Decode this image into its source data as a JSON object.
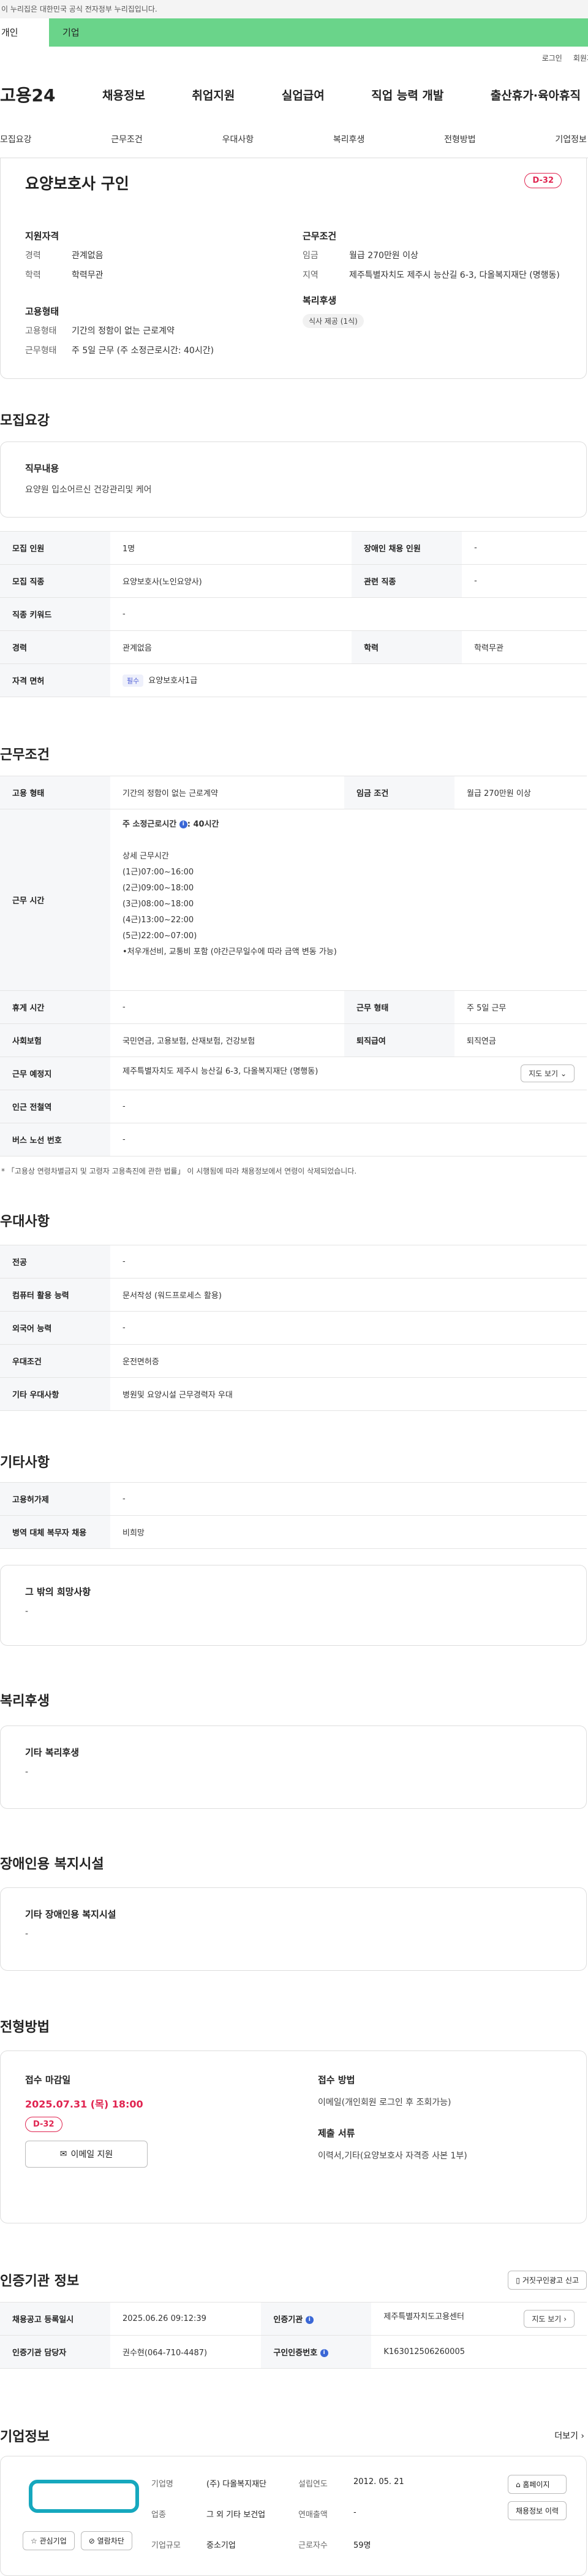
{
  "topbar": {
    "notice": "이 누리집은 대한민국 공식 전자정부 누리집입니다."
  },
  "tabs": [
    {
      "label": "개인"
    },
    {
      "label": "기업"
    }
  ],
  "util": {
    "login": "로그인",
    "join": "회원가입"
  },
  "gnb": {
    "logo": "고용24",
    "menu": [
      "채용정보",
      "취업지원",
      "실업급여",
      "직업 능력 개발",
      "출산휴가·육아휴직"
    ]
  },
  "anchors": [
    "모집요강",
    "근무조건",
    "우대사항",
    "복리후생",
    "전형방법",
    "기업정보"
  ],
  "summary": {
    "title": "요양보호사 구인",
    "dday": "D-32",
    "qual_title": "지원자격",
    "career_k": "경력",
    "career_v": "관계없음",
    "edu_k": "학력",
    "edu_v": "학력무관",
    "emp_title": "고용형태",
    "emp_k": "고용형태",
    "emp_v": "기간의 정함이 없는 근로계약",
    "work_k": "근무형태",
    "work_v": "주 5일 근무 (주 소정근로시간: 40시간)",
    "cond_title": "근무조건",
    "wage_k": "임금",
    "wage_v": "월급 270만원 이상",
    "region_k": "지역",
    "region_v": "제주특별자치도 제주시 능산길 6-3, 다올복지재단 (명행동)",
    "welfare_title": "복리후생",
    "welfare_chip": "식사 제공 (1식)"
  },
  "recruit": {
    "title": "모집요강",
    "job_t": "직무내용",
    "job_d": "요양원 입소어르신 건강관리및 케어",
    "rows": {
      "count_k": "모집 인원",
      "count_v": "1명",
      "disabled_k": "장애인 채용 인원",
      "disabled_v": "-",
      "job_k": "모집 직종",
      "job_v": "요양보호사(노인요양사)",
      "rel_k": "관련 직종",
      "rel_v": "-",
      "kw_k": "직종 키워드",
      "kw_v": "-",
      "career_k": "경력",
      "career_v": "관계없음",
      "edu_k": "학력",
      "edu_v": "학력무관",
      "lic_k": "자격 면허",
      "lic_badge": "필수",
      "lic_v": "요양보호사1급"
    }
  },
  "work": {
    "title": "근무조건",
    "emp_k": "고용 형태",
    "emp_v": "기간의 정함이 없는 근로계약",
    "wage_k": "임금 조건",
    "wage_v": "월급 270만원 이상",
    "time_k": "근무 시간",
    "time_head": "주 소정근로시간",
    "time_head_v": ": 40시간",
    "time_detail_t": "상세 근무시간",
    "time_lines": [
      "(1근)07:00~16:00",
      "(2근)09:00~18:00",
      "(3근)08:00~18:00",
      "(4근)13:00~22:00",
      "(5근)22:00~07:00)",
      "•처우개선비, 교통비 포함 (야간근무일수에 따라 금액 변동 가능)"
    ],
    "rest_k": "휴게 시간",
    "rest_v": "-",
    "form_k": "근무 형태",
    "form_v": "주 5일 근무",
    "ins_k": "사회보험",
    "ins_v": "국민연금, 고용보험, 산재보험, 건강보험",
    "sev_k": "퇴직급여",
    "sev_v": "퇴직연금",
    "place_k": "근무 예정지",
    "place_v": "제주특별자치도 제주시 능산길 6-3, 다올복지재단 (명행동)",
    "map_btn": "지도 보기",
    "station_k": "인근 전철역",
    "station_v": "-",
    "bus_k": "버스 노선 번호",
    "bus_v": "-",
    "note": "* 「고용상 연령차별금지 및 고령자 고용촉진에 관한 법률」 이 시행됨에 따라 채용정보에서 연령이 삭제되었습니다."
  },
  "pref": {
    "title": "우대사항",
    "major_k": "전공",
    "major_v": "-",
    "pc_k": "컴퓨터 활용 능력",
    "pc_v": "문서작성 (워드프로세스 활용)",
    "lang_k": "외국어 능력",
    "lang_v": "-",
    "cond_k": "우대조건",
    "cond_v": "운전면허증",
    "etc_k": "기타 우대사항",
    "etc_v": "병원및 요양시설 근무경력자 우대"
  },
  "other": {
    "title": "기타사항",
    "hire_k": "고용허가제",
    "hire_v": "-",
    "mil_k": "병역 대체 복무자 채용",
    "mil_v": "비희망",
    "wish_t": "그 밖의 희망사항",
    "wish_d": "-"
  },
  "welfare": {
    "title": "복리후생",
    "t": "기타 복리후생",
    "d": "-"
  },
  "disability": {
    "title": "장애인용 복지시설",
    "t": "기타 장애인용 복지시설",
    "d": "-"
  },
  "process": {
    "title": "전형방법",
    "deadline_t": "접수 마감일",
    "deadline_v": "2025.07.31 (목) 18:00",
    "dday": "D-32",
    "apply_btn": "이메일 지원",
    "method_t": "접수 방법",
    "method_v": "이메일(개인회원 로그인 후 조회가능)",
    "docs_t": "제출 서류",
    "docs_v": "이력서,기타(요양보호사 자격증 사본 1부)"
  },
  "agency": {
    "title": "인증기관 정보",
    "report_btn": "거짓구인광고 신고",
    "reg_k": "채용공고 등록일시",
    "reg_v": "2025.06.26 09:12:39",
    "org_k": "인증기관",
    "org_v": "제주특별자치도고용센터",
    "map_btn": "지도 보기",
    "mgr_k": "인증기관 담당자",
    "mgr_v": "권수현(064-710-4487)",
    "no_k": "구인인증번호",
    "no_v": "K163012506260005"
  },
  "company": {
    "title": "기업정보",
    "more": "더보기",
    "name_k": "기업명",
    "name_v": "(주) 다올복지재단",
    "year_k": "설립연도",
    "year_v": "2012. 05. 21",
    "ind_k": "업종",
    "ind_v": "그 외 기타 보건업",
    "sales_k": "연매출액",
    "sales_v": "-",
    "size_k": "기업규모",
    "size_v": "중소기업",
    "emp_k": "근로자수",
    "emp_v": "59명",
    "fav_btn": "관심기업",
    "block_btn": "열람차단",
    "home_btn": "홈페이지",
    "history_btn": "채용정보 이력"
  }
}
